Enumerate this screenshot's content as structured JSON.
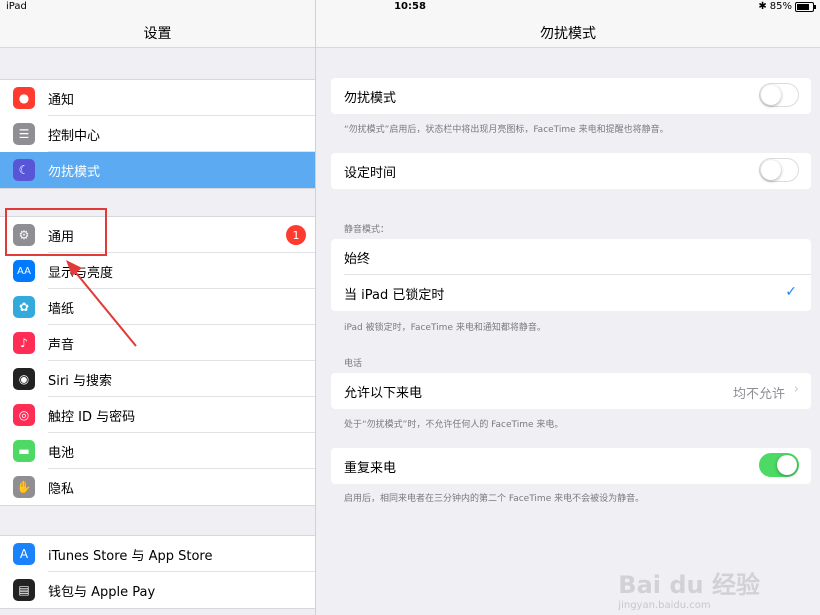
{
  "status_bar": {
    "device": "iPad",
    "time": "10:58",
    "battery": "85%"
  },
  "sidebar": {
    "title": "设置",
    "group1": [
      {
        "label": "通知",
        "icon": "notifications-icon",
        "color": "#ff3b30"
      },
      {
        "label": "控制中心",
        "icon": "control-center-icon",
        "color": "#8e8e93"
      },
      {
        "label": "勿扰模式",
        "icon": "moon-icon",
        "color": "#5856d6",
        "selected": true
      }
    ],
    "group2": [
      {
        "label": "通用",
        "icon": "gear-icon",
        "color": "#8e8e93",
        "badge": "1"
      },
      {
        "label": "显示与亮度",
        "icon": "display-icon",
        "color": "#007aff"
      },
      {
        "label": "墙纸",
        "icon": "wallpaper-icon",
        "color": "#34aadc"
      },
      {
        "label": "声音",
        "icon": "speaker-icon",
        "color": "#ff2d55"
      },
      {
        "label": "Siri 与搜索",
        "icon": "siri-icon",
        "color": "#222"
      },
      {
        "label": "触控 ID 与密码",
        "icon": "fingerprint-icon",
        "color": "#ff2d55"
      },
      {
        "label": "电池",
        "icon": "battery-icon",
        "color": "#4cd964"
      },
      {
        "label": "隐私",
        "icon": "hand-icon",
        "color": "#8e8e93"
      }
    ],
    "group3": [
      {
        "label": "iTunes Store 与 App Store",
        "icon": "app-store-icon",
        "color": "#1a82fb"
      },
      {
        "label": "钱包与 Apple Pay",
        "icon": "wallet-icon",
        "color": "#222"
      }
    ]
  },
  "main": {
    "title": "勿扰模式",
    "dnd": {
      "label": "勿扰模式",
      "on": false,
      "note": "“勿扰模式”启用后，状态栏中将出现月亮图标，FaceTime 来电和提醒也将静音。"
    },
    "scheduled": {
      "label": "设定时间",
      "on": false
    },
    "silence_header": "静音模式：",
    "silence_always": "始终",
    "silence_locked": "当 iPad 已锁定时",
    "silence_note": "iPad 被锁定时，FaceTime 来电和通知都将静音。",
    "phone_header": "电话",
    "allow_calls": {
      "label": "允许以下来电",
      "value": "均不允许"
    },
    "allow_note": "处于“勿扰模式”时，不允许任何人的 FaceTime 来电。",
    "repeated": {
      "label": "重复来电",
      "on": true,
      "note": "启用后，相同来电者在三分钟内的第二个 FaceTime 来电不会被设为静音。"
    }
  },
  "watermark": {
    "brand": "Bai du 经验",
    "url": "jingyan.baidu.com"
  }
}
